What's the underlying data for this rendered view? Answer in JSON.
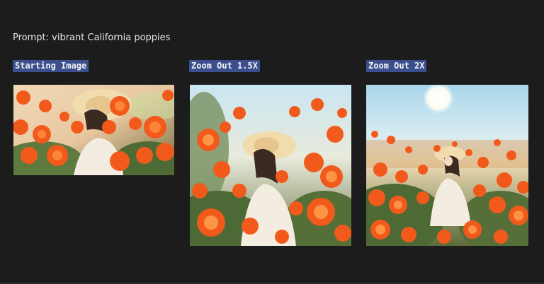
{
  "prompt": "Prompt: vibrant California poppies",
  "images": [
    {
      "label": "Starting Image"
    },
    {
      "label": "Zoom Out 1.5X"
    },
    {
      "label": "Zoom Out 2X"
    }
  ],
  "colors": {
    "background": "#1c1c1d",
    "label_bg": "#3b4f8f",
    "poppy": "#f25a1c",
    "sky": "#bfe2f2"
  }
}
